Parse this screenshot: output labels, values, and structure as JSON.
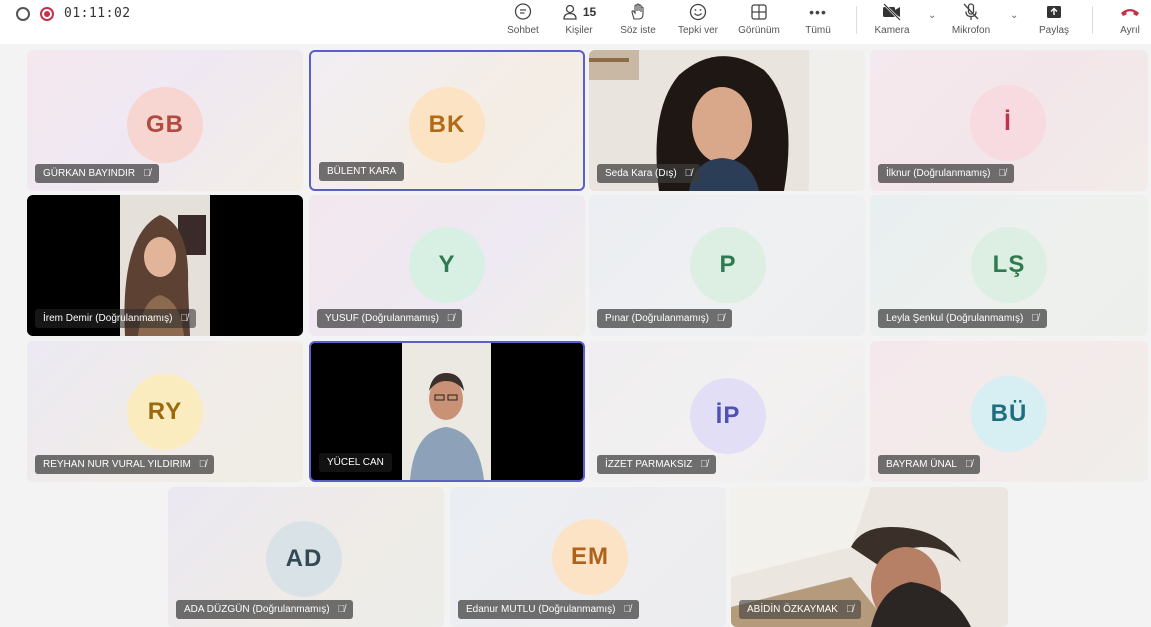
{
  "toolbar": {
    "timer": "01:11:02",
    "people_count": "15",
    "buttons": [
      {
        "key": "chat",
        "label": "Sohbet",
        "icon": "chat-icon"
      },
      {
        "key": "people",
        "label": "Kişiler",
        "icon": "people-icon"
      },
      {
        "key": "raise",
        "label": "Söz iste",
        "icon": "raise-hand-icon"
      },
      {
        "key": "react",
        "label": "Tepki ver",
        "icon": "smiley-icon"
      },
      {
        "key": "view",
        "label": "Görünüm",
        "icon": "grid-view-icon"
      },
      {
        "key": "more",
        "label": "Tümü",
        "icon": "more-icon"
      },
      {
        "key": "camera",
        "label": "Kamera",
        "icon": "camera-off-icon"
      },
      {
        "key": "mic",
        "label": "Mikrofon",
        "icon": "mic-off-icon"
      },
      {
        "key": "share",
        "label": "Paylaş",
        "icon": "share-icon"
      },
      {
        "key": "leave",
        "label": "Ayrıl",
        "icon": "phone-hangup-icon"
      }
    ]
  },
  "colors": {
    "accent": "#5b5fc7",
    "hangup": "#c4314b"
  },
  "participants": [
    {
      "name": "GÜRKAN BAYINDIR",
      "initials": "GB",
      "muted": true,
      "avatar_color": "#f7d6d2",
      "text_color": "#b24a3f"
    },
    {
      "name": "BÜLENT KARA",
      "initials": "BK",
      "muted": false,
      "avatar_color": "#fbe3c4",
      "text_color": "#b06a18"
    },
    {
      "name": "Seda Kara (Dış)",
      "initials": "",
      "muted": true,
      "video": true
    },
    {
      "name": "İlknur (Doğrulanmamış)",
      "initials": "İ",
      "muted": true,
      "avatar_color": "#f7dbe0",
      "text_color": "#c4314b"
    },
    {
      "name": "İrem Demir (Doğrulanmamış)",
      "initials": "",
      "muted": true,
      "video": true
    },
    {
      "name": "YUSUF (Doğrulanmamış)",
      "initials": "Y",
      "muted": true,
      "avatar_color": "#d8efe3",
      "text_color": "#2f7a4f"
    },
    {
      "name": "Pınar (Doğrulanmamış)",
      "initials": "P",
      "muted": true,
      "avatar_color": "#dcefe2",
      "text_color": "#2f7a4f"
    },
    {
      "name": "Leyla Şenkul (Doğrulanmamış)",
      "initials": "LŞ",
      "muted": true,
      "avatar_color": "#ddefe3",
      "text_color": "#2f7a4f"
    },
    {
      "name": "REYHAN NUR VURAL YILDIRIM",
      "initials": "RY",
      "muted": true,
      "avatar_color": "#fbecc0",
      "text_color": "#9a6a0c"
    },
    {
      "name": "YÜCEL CAN",
      "initials": "",
      "muted": false,
      "video": true
    },
    {
      "name": "İZZET PARMAKSIZ",
      "initials": "İP",
      "muted": true,
      "avatar_color": "#e2def6",
      "text_color": "#4f52b2"
    },
    {
      "name": "BAYRAM ÜNAL",
      "initials": "BÜ",
      "muted": true,
      "avatar_color": "#d7eef2",
      "text_color": "#1f6e80"
    },
    {
      "name": "ADA DÜZGÜN (Doğrulanmamış)",
      "initials": "AD",
      "muted": true,
      "avatar_color": "#d9e2e6",
      "text_color": "#334a54"
    },
    {
      "name": "Edanur MUTLU (Doğrulanmamış)",
      "initials": "EM",
      "muted": true,
      "avatar_color": "#fce3c6",
      "text_color": "#b0621a"
    },
    {
      "name": "ABİDİN ÖZKAYMAK",
      "initials": "",
      "muted": true,
      "video": true
    }
  ]
}
